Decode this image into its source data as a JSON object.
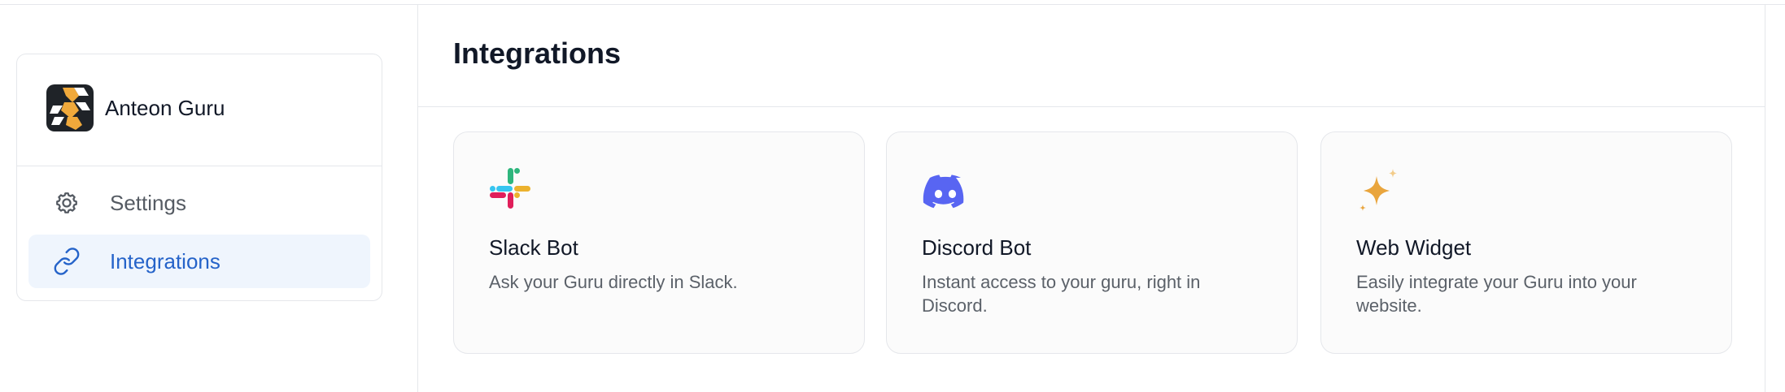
{
  "sidebar": {
    "guru": {
      "name": "Anteon Guru",
      "logo_icon": "anteon-logo-icon"
    },
    "items": [
      {
        "label": "Settings",
        "icon": "gear-icon",
        "active": false
      },
      {
        "label": "Integrations",
        "icon": "link-icon",
        "active": true
      }
    ]
  },
  "main": {
    "title": "Integrations",
    "cards": [
      {
        "title": "Slack Bot",
        "description": "Ask your Guru directly in Slack.",
        "icon": "slack-icon"
      },
      {
        "title": "Discord Bot",
        "description": "Instant access to your guru, right in Discord.",
        "icon": "discord-icon"
      },
      {
        "title": "Web Widget",
        "description": "Easily integrate your Guru into your website.",
        "icon": "sparkle-icon"
      }
    ]
  },
  "colors": {
    "accent": "#2563c9",
    "active_bg": "#eff5fd",
    "discord": "#5865f2",
    "widget": "#e9a53d",
    "logo_orange": "#f0a93b"
  }
}
